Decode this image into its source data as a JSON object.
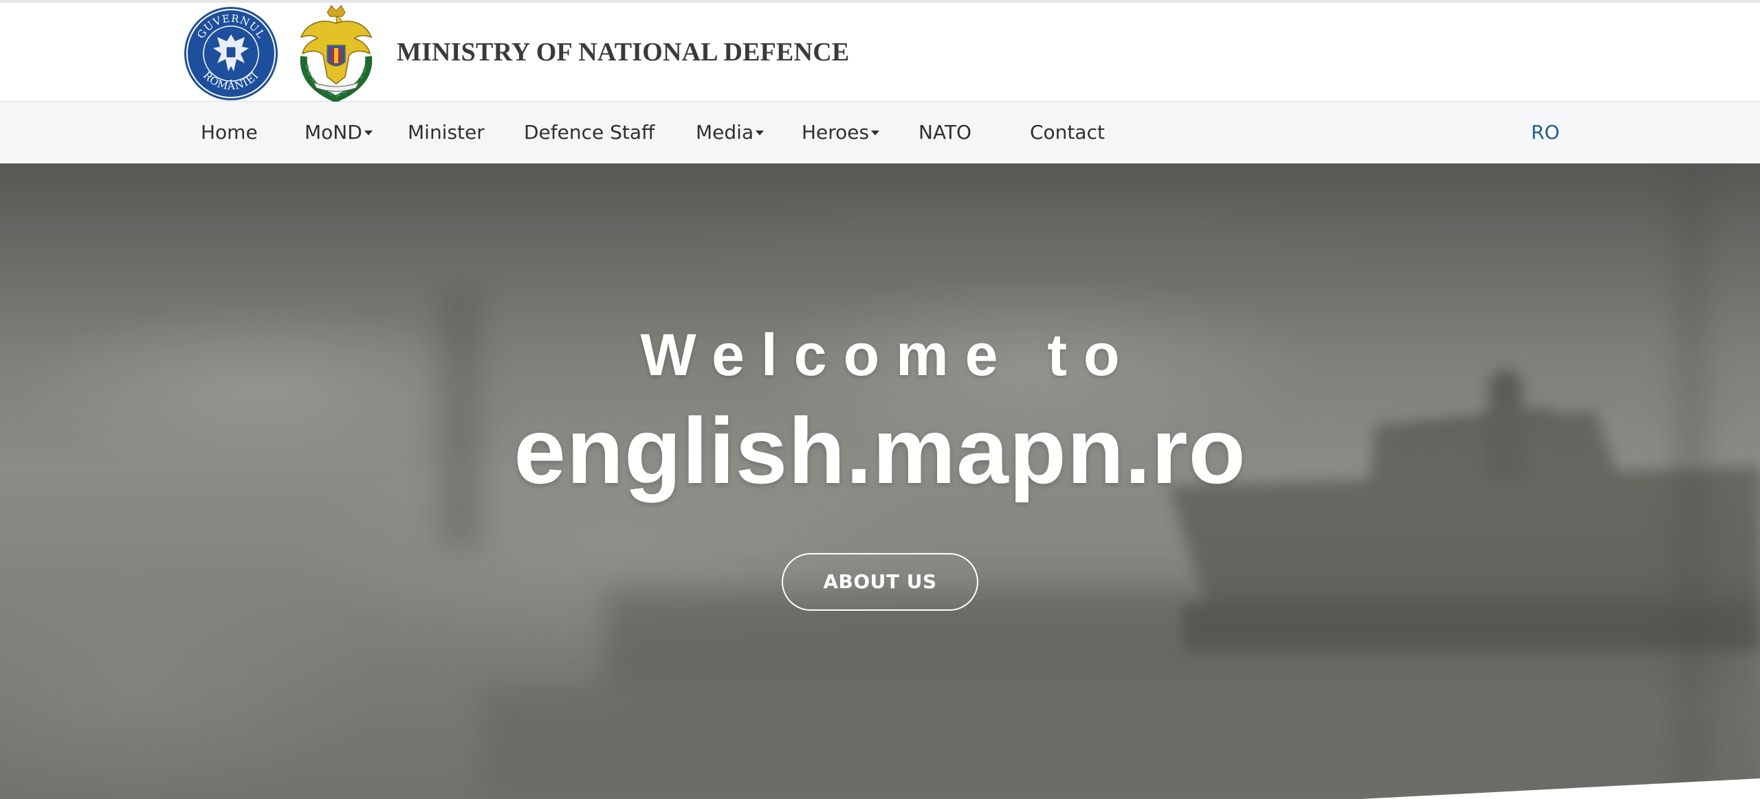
{
  "header": {
    "title": "MINISTRY OF NATIONAL DEFENCE",
    "gov_seal_text": "GUVERNUL ROMÂNIEI"
  },
  "nav": {
    "items": [
      {
        "label": "Home",
        "dropdown": false
      },
      {
        "label": "MoND",
        "dropdown": true
      },
      {
        "label": "Minister",
        "dropdown": false
      },
      {
        "label": "Defence Staff",
        "dropdown": false
      },
      {
        "label": "Media",
        "dropdown": true
      },
      {
        "label": "Heroes",
        "dropdown": true
      },
      {
        "label": "NATO",
        "dropdown": false
      },
      {
        "label": "Contact",
        "dropdown": false
      }
    ],
    "language": "RO"
  },
  "hero": {
    "welcome": "Welcome to",
    "site": "english.mapn.ro",
    "button_label": "ABOUT US"
  },
  "colors": {
    "seal_blue": "#1d4f9c",
    "crest_gold": "#e3c227",
    "nav_background": "#f5f6f8",
    "language_link": "#1f5f8b",
    "title_text": "#3a3a3a"
  }
}
